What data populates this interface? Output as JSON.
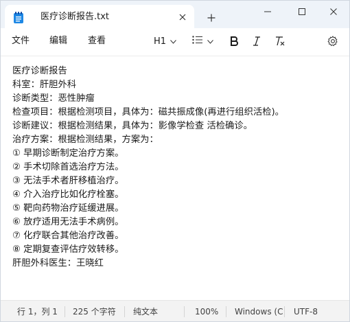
{
  "window": {
    "tab_title": "医疗诊断报告.txt"
  },
  "menu": {
    "file": "文件",
    "edit": "编辑",
    "view": "查看"
  },
  "toolbar": {
    "heading_label": "H1"
  },
  "document": {
    "lines": [
      "医疗诊断报告",
      "科室：肝胆外科",
      "诊断类型：恶性肿瘤",
      "检查项目：根据检测项目，具体为：磁共振成像(再进行组织活检)。",
      "诊断建议：根据检测结果，具体为：影像学检查 活检确诊。",
      "治疗方案：根据检测结果，方案为：",
      "① 早期诊断制定治疗方案。",
      "② 手术切除首选治疗方法。",
      "③ 无法手术者肝移植治疗。",
      "④ 介入治疗比如化疗栓塞。",
      "⑤ 靶向药物治疗延缓进展。",
      "⑥ 放疗适用无法手术病例。",
      "⑦ 化疗联合其他治疗改善。",
      "⑧ 定期复查评估疗效转移。",
      "肝胆外科医生：王晓红"
    ]
  },
  "status": {
    "position": "行 1，列 1",
    "chars": "225 个字符",
    "format": "纯文本",
    "zoom": "100%",
    "line_ending": "Windows (CRLF)",
    "encoding": "UTF-8"
  },
  "icons": {
    "app": "notepad-icon",
    "close_tab": "close-icon",
    "new_tab": "plus-icon",
    "minimize": "minimize-icon",
    "maximize": "maximize-icon",
    "close_window": "close-icon",
    "list": "list-icon",
    "bold": "bold-icon",
    "italic": "italic-icon",
    "clear_format": "clear-formatting-icon",
    "settings": "gear-icon"
  },
  "colors": {
    "titlebar_bg": "#eef3f9",
    "app_icon": "#1e88e5",
    "statusbar_bg": "#f3f3f3"
  }
}
